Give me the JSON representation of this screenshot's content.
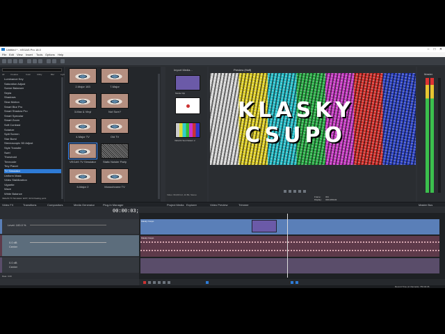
{
  "window": {
    "title": "Untitled * - VEGAS Pro 18.0",
    "controls": [
      "–",
      "□",
      "✕"
    ]
  },
  "menu": [
    "File",
    "Edit",
    "View",
    "Insert",
    "Tools",
    "Options",
    "Help"
  ],
  "fx_panel": {
    "filters": [
      "All",
      "Creative",
      "Color",
      "Utility",
      "Blur",
      "Light",
      "OFX",
      "Third Party",
      "Favorites"
    ],
    "items": [
      "Luminance Key",
      "Saturation Adjust",
      "Scene Balancer",
      "Sepia",
      "Shadows",
      "Slow Motion",
      "Smart Blur Pro",
      "Smart Shadow Pro",
      "Smart Specular",
      "Smart Zoom",
      "Soft Contrast",
      "Solarize",
      "Split Screen",
      "Star Burst",
      "Stereoscopic 3D Adjust",
      "Style Transfer",
      "Swirl",
      "Threshold",
      "Timecode",
      "Tiny Planet",
      "TV Simulator",
      "Uniform Mask",
      "Video Stabilization",
      "Vignette",
      "Wave",
      "White Balance"
    ],
    "selected": "TV Simulator"
  },
  "thumbnails": [
    "2-Major 183",
    "7-Major",
    "3-Max & Vinyl",
    "Not Sure?",
    "4-Major TV",
    "Old TV",
    "VEGAS TV Simulator",
    "Static Noisier Party",
    "6-Major 2",
    "Monochrome TV"
  ],
  "media": {
    "items": [
      "Media Clip",
      "",
      "VEGAS Test Pattern 2"
    ],
    "info": [
      "Video: 96,000 Hz, 24 Bit, Stereo"
    ]
  },
  "preview": {
    "menu": "Preview (Half)",
    "overlay_line1": "KLASKY",
    "overlay_line2": "CSUPO",
    "frame_label": "Frame:",
    "frame_value": "331",
    "display_label": "Display:",
    "display_value": "320x180x32"
  },
  "meter": {
    "title": "Master",
    "label": "Master Bus"
  },
  "tabs": [
    "Video FX",
    "Transitions",
    "Compositors",
    "Media Generator",
    "Plug-In Manager",
    "Project Media",
    "Explorer",
    "Video Preview",
    "Trimmer",
    "Master Bus"
  ],
  "fx_status": "VEGAS TV Simulator: EXIT, 32 bit floating point",
  "timeline": {
    "timecode": "00:00:03;06",
    "level": "Level: 100.0 %",
    "vol": "0.0 dB",
    "pan": "Center",
    "clip_label": "Klasky Csupo",
    "audio_label": "Klasky Csupo",
    "rate": "Rate: 0.00",
    "time_record": "Record Time (2 channels): 750:04:36"
  },
  "colors": {
    "accent": "#2e7bd6",
    "video_track": "#5a7fb8",
    "audio_track": "#5e3a4a"
  }
}
